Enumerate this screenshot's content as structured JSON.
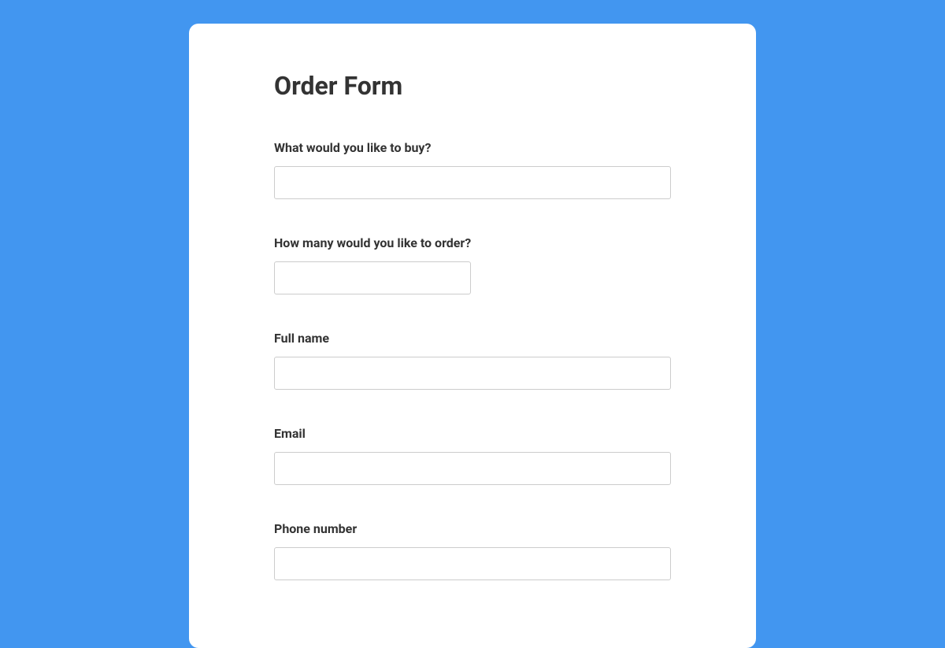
{
  "form": {
    "title": "Order Form",
    "fields": {
      "item": {
        "label": "What would you like to buy?",
        "value": ""
      },
      "quantity": {
        "label": "How many would you like to order?",
        "value": ""
      },
      "fullname": {
        "label": "Full name",
        "value": ""
      },
      "email": {
        "label": "Email",
        "value": ""
      },
      "phone": {
        "label": "Phone number",
        "value": ""
      }
    }
  },
  "colors": {
    "background": "#4296f0",
    "card": "#ffffff",
    "text": "#333333",
    "border": "#cccccc"
  }
}
